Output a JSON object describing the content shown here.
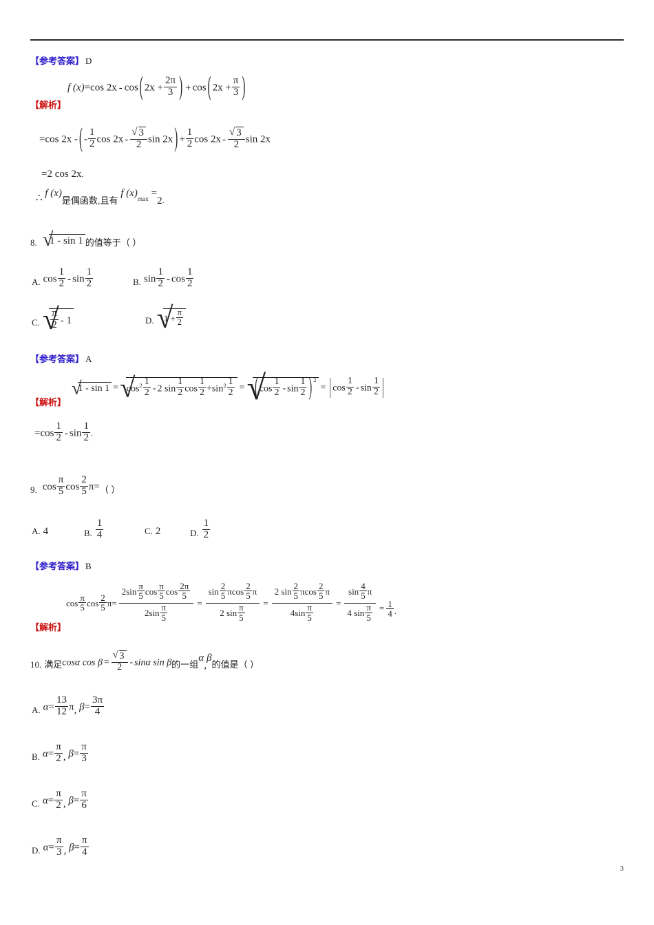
{
  "document": {
    "page_number": "3",
    "colors": {
      "answer_label": "#3322cc",
      "solution_label": "#cc1111",
      "text": "#231f20",
      "rule": "#2b2b2b"
    },
    "labels": {
      "reference_answer": "【参考答案】",
      "analysis": "【解析】"
    }
  },
  "q7_solution": {
    "answer_value": "D",
    "line1": {
      "fx": "f (x)",
      "eq": "=",
      "cos2x": "cos 2x",
      "minus": "-",
      "cos_a": "cos",
      "inner_a": "2x +",
      "frac_a_num": "2π",
      "frac_a_den": "3",
      "plus": "+",
      "cos_b": "cos",
      "inner_b": "2x +",
      "frac_b_num": "π",
      "frac_b_den": "3"
    },
    "line2": {
      "lead": "=cos 2x -",
      "t1_sign": "-",
      "t1_num": "1",
      "t1_den": "2",
      "t1_fn": "cos 2x",
      "t2_sign": "-",
      "t2_num": "3",
      "t2_den": "2",
      "t2_fn": "sin 2x",
      "plus": "+",
      "t3_num": "1",
      "t3_den": "2",
      "t3_fn": "cos 2x",
      "t4_sign": "-",
      "t4_num": "3",
      "t4_den": "2",
      "t4_fn": "sin 2x"
    },
    "line3": "=2 cos 2x",
    "line3_period": ".",
    "line4": {
      "therefore": "∴",
      "fx": "f (x)",
      "text1": "是偶函数,且有",
      "fx2": "f (x)",
      "max_sub": "max",
      "eq": "=",
      "value": "2",
      "period": "."
    }
  },
  "q8": {
    "number": "8.",
    "stem_radicand": "1 - sin 1",
    "stem_text": "的值等于（      ）",
    "options": [
      {
        "letter": "A.",
        "parts": {
          "f1": "cos",
          "n1": "1",
          "d1": "2",
          "op": "-",
          "f2": "sin",
          "n2": "1",
          "d2": "2"
        }
      },
      {
        "letter": "B.",
        "parts": {
          "f1": "sin",
          "n1": "1",
          "d1": "2",
          "op": "-",
          "f2": "cos",
          "n2": "1",
          "d2": "2"
        }
      },
      {
        "letter": "C.",
        "parts": {
          "num": "π",
          "den": "2",
          "op": "- 1"
        }
      },
      {
        "letter": "D.",
        "parts": {
          "lead": "1 +",
          "num": "π",
          "den": "2"
        }
      }
    ]
  },
  "q8_solution": {
    "answer_value": "A",
    "line1": {
      "root1": "1 - sin 1",
      "eq1": "=",
      "cos2": "cos",
      "cos2_sup": "2",
      "cn1": "1",
      "cd1": "2",
      "minus": "-",
      "two_sin": "2 sin",
      "sn1": "1",
      "sd1": "2",
      "cos_b": "cos",
      "cn2": "1",
      "cd2": "2",
      "plus": "+",
      "sin2": "sin",
      "sin2_sup": "2",
      "sn2": "1",
      "sd2": "2",
      "eq2": "=",
      "inner_cos": "cos",
      "icn": "1",
      "icd": "2",
      "inner_minus": "-",
      "inner_sin": "sin",
      "isn": "1",
      "isd": "2",
      "sq_sup": "2",
      "eq3": "=",
      "abs_cos": "cos",
      "acn": "1",
      "acd": "2",
      "abs_minus": "-",
      "abs_sin": "sin",
      "asn": "1",
      "asd": "2"
    },
    "line2": {
      "lead": "=cos",
      "n1": "1",
      "d1": "2",
      "op": "-",
      "fn2": "sin",
      "n2": "1",
      "d2": "2",
      "period": "."
    }
  },
  "q9": {
    "number": "9.",
    "stem": {
      "cos1": "cos",
      "n1": "π",
      "d1": "5",
      "cos2": "cos",
      "n2": "2",
      "d2": "5",
      "pi": "π=",
      "paren": "（      ）"
    },
    "options": [
      {
        "letter": "A.",
        "value": "4"
      },
      {
        "letter": "B.",
        "num": "1",
        "den": "4"
      },
      {
        "letter": "C.",
        "value": "2"
      },
      {
        "letter": "D.",
        "num": "1",
        "den": "2"
      }
    ]
  },
  "q9_solution": {
    "answer_value": "B",
    "lhs": {
      "cos1": "cos",
      "n1": "π",
      "d1": "5",
      "cos2": "cos",
      "n2": "2",
      "d2": "5",
      "pi": "π="
    },
    "frac1": {
      "num": {
        "two_sin": "2sin",
        "n1": "π",
        "d1": "5",
        "cos1": "cos",
        "n2": "π",
        "d2": "5",
        "cos2": "cos",
        "n3": "2π",
        "d3": "5"
      },
      "den": {
        "two_sin": "2sin",
        "n": "π",
        "d": "5"
      }
    },
    "eq1": "=",
    "frac2": {
      "num": {
        "sin": "sin",
        "n1": "2",
        "d1": "5",
        "pi1": "π",
        "cos": "cos",
        "n2": "2",
        "d2": "5",
        "pi2": "π"
      },
      "den": {
        "two_sin": "2 sin",
        "n": "π",
        "d": "5"
      }
    },
    "eq2": "=",
    "frac3": {
      "num": {
        "two_sin": "2 sin",
        "n1": "2",
        "d1": "5",
        "pi1": "π",
        "cos": "cos",
        "n2": "2",
        "d2": "5",
        "pi2": "π"
      },
      "den": {
        "four_sin": "4sin",
        "n": "π",
        "d": "5"
      }
    },
    "eq3": "=",
    "frac4": {
      "num": {
        "sin": "sin",
        "n1": "4",
        "d1": "5",
        "pi1": "π"
      },
      "den": {
        "four_sin": "4 sin",
        "n": "π",
        "d": "5"
      }
    },
    "eq4": "=",
    "result": {
      "num": "1",
      "den": "4"
    },
    "period": "."
  },
  "q10": {
    "number": "10.",
    "lead": "满足",
    "condition": {
      "lhs": "cosα cos β",
      "eq": "=",
      "frac_num": "3",
      "frac_den": "2",
      "minus": "-",
      "rhs": "sinα sin β"
    },
    "tail1": "的一组",
    "alpha": "α",
    "comma": ",",
    "beta": "β",
    "tail2": "的值是（      ）",
    "options": [
      {
        "letter": "A.",
        "alpha_var": "α",
        "alpha_eq": "=",
        "alpha_num": "13",
        "alpha_den": "12",
        "alpha_unit": "π",
        "comma": ",",
        "beta_var": "β",
        "beta_eq": "=",
        "beta_num": "3π",
        "beta_den": "4",
        "beta_unit": ""
      },
      {
        "letter": "B.",
        "alpha_var": "α",
        "alpha_eq": "=",
        "alpha_num": "π",
        "alpha_den": "2",
        "alpha_unit": "",
        "comma": ",",
        "beta_var": "β",
        "beta_eq": "=",
        "beta_num": "π",
        "beta_den": "3",
        "beta_unit": ""
      },
      {
        "letter": "C.",
        "alpha_var": "α",
        "alpha_eq": "=",
        "alpha_num": "π",
        "alpha_den": "2",
        "alpha_unit": "",
        "comma": ",",
        "beta_var": "β",
        "beta_eq": "=",
        "beta_num": "π",
        "beta_den": "6",
        "beta_unit": ""
      },
      {
        "letter": "D.",
        "alpha_var": "α",
        "alpha_eq": "=",
        "alpha_num": "π",
        "alpha_den": "3",
        "alpha_unit": "",
        "comma": ",",
        "beta_var": "β",
        "beta_eq": "=",
        "beta_num": "π",
        "beta_den": "4",
        "beta_unit": ""
      }
    ]
  }
}
